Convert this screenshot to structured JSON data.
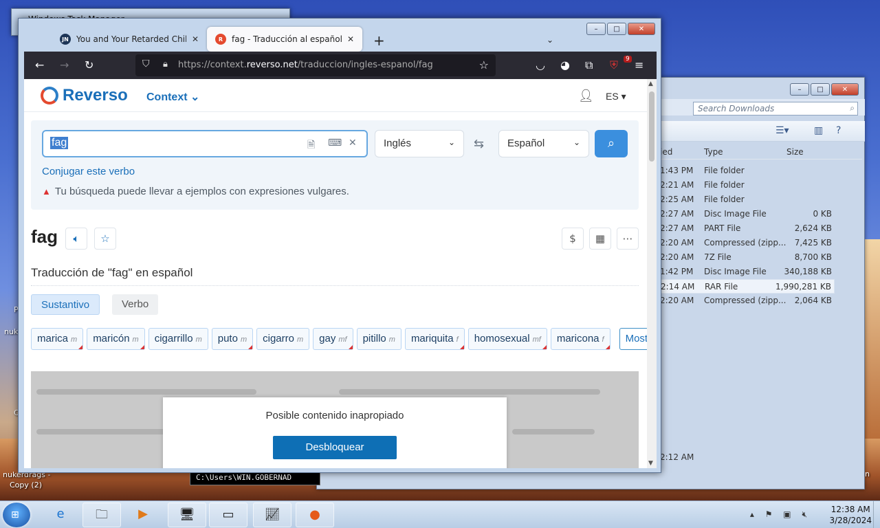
{
  "desktop": {
    "labels": [
      "nuk",
      "nukerdrags -",
      "Copy (2)",
      "C",
      "P"
    ]
  },
  "task_manager": {
    "title": "Windows Task Manager"
  },
  "explorer": {
    "search_placeholder": "Search Downloads",
    "columns": [
      "ied",
      "Type",
      "Size"
    ],
    "rows": [
      {
        "date": "1:43 PM",
        "type": "File folder",
        "size": ""
      },
      {
        "date": "2:21 AM",
        "type": "File folder",
        "size": ""
      },
      {
        "date": "2:25 AM",
        "type": "File folder",
        "size": ""
      },
      {
        "date": "2:27 AM",
        "type": "Disc Image File",
        "size": "0 KB"
      },
      {
        "date": "2:27 AM",
        "type": "PART File",
        "size": "2,624 KB"
      },
      {
        "date": "2:20 AM",
        "type": "Compressed (zipp...",
        "size": "7,425 KB"
      },
      {
        "date": "2:20 AM",
        "type": "7Z File",
        "size": "8,700 KB"
      },
      {
        "date": "1:42 PM",
        "type": "Disc Image File",
        "size": "340,188 KB"
      },
      {
        "date": "2:14 AM",
        "type": "RAR File",
        "size": "1,990,281 KB"
      },
      {
        "date": "2:20 AM",
        "type": "Compressed (zipp...",
        "size": "2,064 KB"
      }
    ],
    "status_time": "2:12 AM",
    "edge_text": "n"
  },
  "cmd_window": {
    "text": "C:\\Users\\WIN.GOBERNAD"
  },
  "firefox": {
    "tabs": [
      {
        "title": "You and Your Retarded Child: A",
        "favicon": "JN",
        "active": false
      },
      {
        "title": "fag - Traducción al español - ej",
        "favicon": "R",
        "active": true
      }
    ],
    "url_prefix": "https://context.",
    "url_domain": "reverso.net",
    "url_path": "/traduccion/ingles-espanol/fag",
    "extension_badge": "9"
  },
  "reverso": {
    "logo_text": "Reverso",
    "context_label": "Context",
    "lang_label": "ES",
    "search_query": "fag",
    "source_lang": "Inglés",
    "target_lang": "Español",
    "conjugate_link": "Conjugar este verbo",
    "warning": "Tu búsqueda puede llevar a ejemplos con expresiones vulgares.",
    "entry_word": "fag",
    "translation_heading": "Traducción de \"fag\" en español",
    "pos_tabs": [
      "Sustantivo",
      "Verbo"
    ],
    "translations": [
      {
        "word": "marica",
        "gender": "m",
        "flag": true
      },
      {
        "word": "maricón",
        "gender": "m",
        "flag": true
      },
      {
        "word": "cigarrillo",
        "gender": "m",
        "flag": false
      },
      {
        "word": "puto",
        "gender": "m",
        "flag": true
      },
      {
        "word": "cigarro",
        "gender": "m",
        "flag": false
      },
      {
        "word": "gay",
        "gender": "mf",
        "flag": true
      },
      {
        "word": "pitillo",
        "gender": "m",
        "flag": false
      },
      {
        "word": "mariquita",
        "gender": "f",
        "flag": true
      },
      {
        "word": "homosexual",
        "gender": "mf",
        "flag": true
      },
      {
        "word": "maricona",
        "gender": "f",
        "flag": true
      }
    ],
    "more_button": "Mostrar más",
    "modal_message": "Posible contenido inapropiado",
    "modal_button": "Desbloquear"
  },
  "taskbar": {
    "time": "12:38 AM",
    "date": "3/28/2024"
  }
}
